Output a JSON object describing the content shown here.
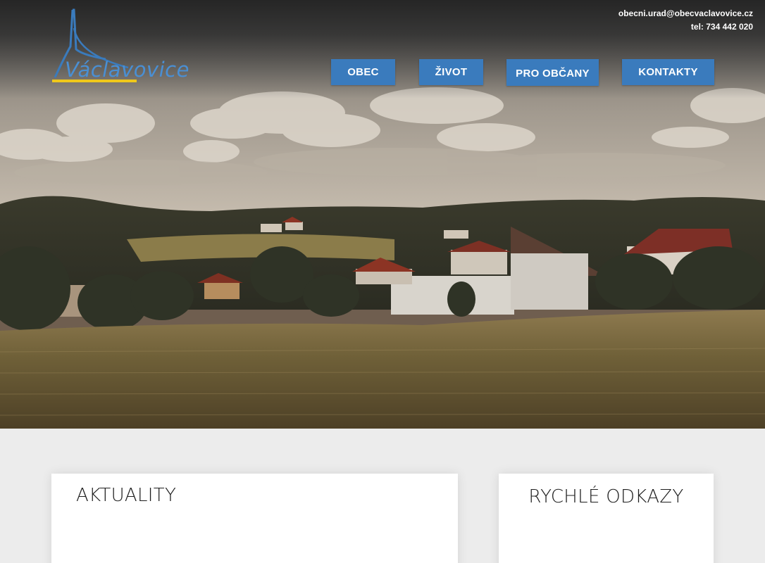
{
  "logo": {
    "text": "Václavovice",
    "icon": "church-spire-logo-icon",
    "brand_color": "#4a8fd3",
    "underline_color": "#f0c81a"
  },
  "contact": {
    "email": "obecni.urad@obecvaclavovice.cz",
    "phone": "tel: 734 442 020"
  },
  "nav": {
    "items": [
      {
        "label": "OBEC"
      },
      {
        "label": "ŽIVOT"
      },
      {
        "label": "PRO OBČANY"
      },
      {
        "label": "KONTAKTY"
      }
    ],
    "button_color": "#3a7bbd"
  },
  "hero": {
    "image": "village-landscape-photo"
  },
  "sections": {
    "news_title": "AKTUALITY",
    "quick_links_title": "RYCHLÉ ODKAZY"
  }
}
